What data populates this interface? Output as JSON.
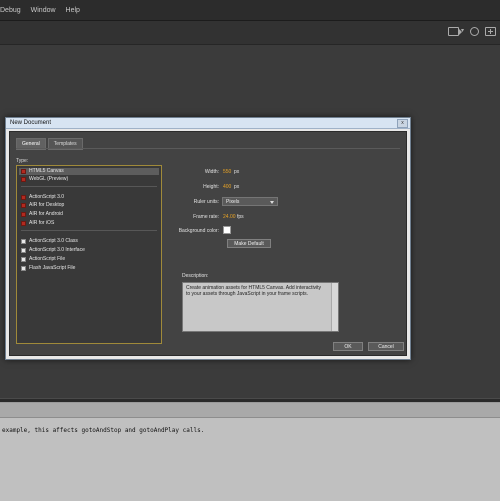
{
  "menu": {
    "items": [
      "Debug",
      "Window",
      "Help"
    ]
  },
  "dialog": {
    "title": "New Document",
    "close_label": "x",
    "tabs": [
      "General",
      "Templates"
    ],
    "type_label": "Type:",
    "types": [
      "HTML5 Canvas",
      "WebGL (Preview)",
      "ActionScript 3.0",
      "AIR for Desktop",
      "AIR for Android",
      "AIR for iOS",
      "ActionScript 3.0 Class",
      "ActionScript 3.0 Interface",
      "ActionScript File",
      "Flash JavaScript File"
    ],
    "selected_type": "HTML5 Canvas",
    "width_label": "Width:",
    "width_value": "550",
    "width_unit": "px",
    "height_label": "Height:",
    "height_value": "400",
    "height_unit": "px",
    "ruler_label": "Ruler units:",
    "ruler_value": "Pixels",
    "framerate_label": "Frame rate:",
    "framerate_value": "24.00",
    "framerate_unit": "fps",
    "bg_label": "Background color:",
    "bg_color": "#ffffff",
    "make_default": "Make Default",
    "description_label": "Description:",
    "description_text": "Create animation assets for HTML5 Canvas. Add interactivity to your assets through JavaScript in your frame scripts.",
    "ok_label": "OK",
    "cancel_label": "Cancel"
  },
  "output": {
    "text": "example, this affects gotoAndStop and gotoAndPlay calls."
  }
}
